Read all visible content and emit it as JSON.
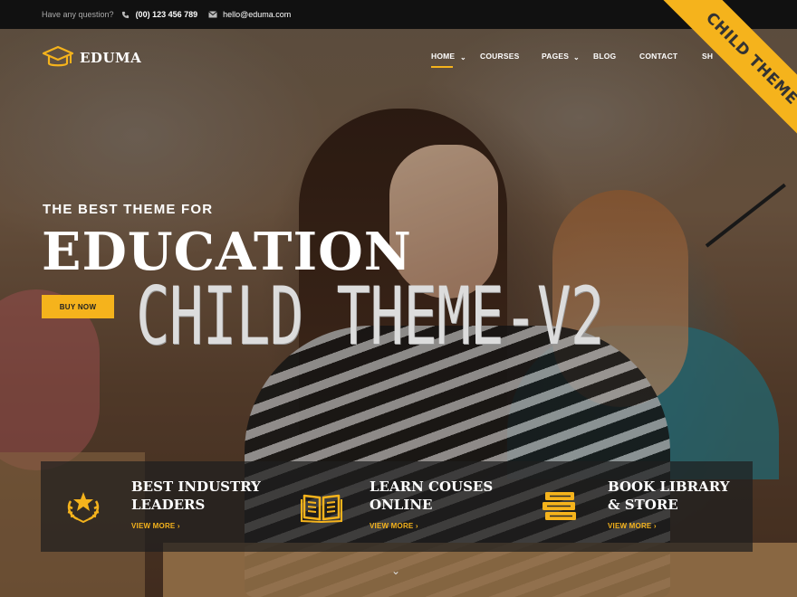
{
  "topbar": {
    "question": "Have any question?",
    "phone": "(00) 123 456 789",
    "email": "hello@eduma.com"
  },
  "ribbon": {
    "label": "CHILD THEME"
  },
  "logo": {
    "text": "EDUMA",
    "icon": "graduation-cap-icon"
  },
  "nav": {
    "items": [
      {
        "label": "HOME",
        "active": true,
        "dropdown": true
      },
      {
        "label": "COURSES",
        "dropdown": false
      },
      {
        "label": "PAGES",
        "dropdown": true
      },
      {
        "label": "BLOG",
        "dropdown": false
      },
      {
        "label": "CONTACT",
        "dropdown": false
      },
      {
        "label": "SH",
        "dropdown": false
      }
    ]
  },
  "hero": {
    "subtitle": "THE BEST THEME FOR",
    "title": "EDUCATION",
    "button": "BUY NOW",
    "overlay": "CHILD THEME-V2"
  },
  "features": [
    {
      "line1": "BEST INDUSTRY",
      "line2": "LEADERS",
      "link": "VIEW MORE ›",
      "icon": "star-laurel-icon"
    },
    {
      "line1": "LEARN COUSES",
      "line2": "ONLINE",
      "link": "VIEW MORE ›",
      "icon": "open-book-icon"
    },
    {
      "line1": "BOOK LIBRARY",
      "line2": "& STORE",
      "link": "VIEW MORE ›",
      "icon": "book-stack-icon"
    }
  ],
  "colors": {
    "accent": "#f5b31c",
    "topbar": "#111111"
  }
}
